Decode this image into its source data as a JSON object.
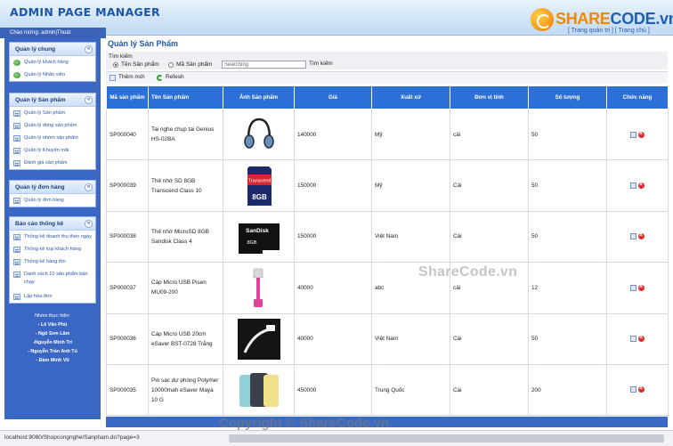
{
  "header": {
    "title": "ADMIN PAGE MANAGER",
    "logo_part1": "SHARE",
    "logo_part2": "CODE.vn",
    "logo_links": "[ Trang quản trị ] [ Trang chủ ]"
  },
  "greeting": "Chào mừng: admin|Thoát",
  "sidebar": {
    "panels": [
      {
        "title": "Quản lý chung",
        "items": [
          "Quản lý khách hàng",
          "Quản lý Nhân viên"
        ]
      },
      {
        "title": "Quản lý Sản phẩm",
        "items": [
          "Quản lý Sản phẩm",
          "Quản lý dòng sản phẩm",
          "Quản lý nhóm sản phẩm",
          "Quản lý Khuyến mãi",
          "Đánh giá sản phẩm"
        ]
      },
      {
        "title": "Quản lý đơn hàng",
        "items": [
          "Quản lý đơn hàng"
        ]
      },
      {
        "title": "Báo cáo thống kê",
        "items": [
          "Thống kê doanh thu theo ngày",
          "Thống kê loại khách hàng",
          "Thống kê hàng tồn",
          "Danh sách 10 sản phẩm bán chạy",
          "Lập hóa đơn"
        ]
      }
    ],
    "collapse_symbol": "«",
    "credits_title": "Nhóm thực hiện:",
    "credits": [
      "- Lê Văn Phú",
      "- Ngô Sơn Lâm",
      "-Nguyễn Minh Trí",
      "- Nguyễn Trần Anh Tú",
      "- Đàm Minh Vũ"
    ]
  },
  "main": {
    "title": "Quản lý Sản Phẩm",
    "search": {
      "label": "Tìm kiếm",
      "option1": "Tên Sản phẩm",
      "option2": "Mã Sản phẩm",
      "placeholder": "Searching",
      "button": "Tìm kiếm"
    },
    "toolbar": {
      "add": "Thêm mới",
      "refresh": "Refesh"
    },
    "columns": [
      "Mã sản phẩm",
      "Tên Sản phẩm",
      "Ảnh Sản phẩm",
      "Giá",
      "Xuất xứ",
      "Đơn vị tính",
      "Số lượng",
      "Chức năng"
    ],
    "rows": [
      {
        "id": "SP000040",
        "name": "Tai nghe chụp tai Genius HS-02BA",
        "image": "headphones",
        "price": "140000",
        "origin": "Mỹ",
        "unit": "cái",
        "qty": "50"
      },
      {
        "id": "SP000039",
        "name": "Thẻ nhớ SD 8GB Transcend Class 10",
        "image": "sd-card",
        "price": "150000",
        "origin": "Mỹ",
        "unit": "Cái",
        "qty": "50"
      },
      {
        "id": "SP000038",
        "name": "Thẻ nhớ MicroSD 8GB Sandisk Class 4",
        "image": "microsd-card",
        "price": "150000",
        "origin": "Việt Nam",
        "unit": "Cái",
        "qty": "50"
      },
      {
        "id": "SP000037",
        "name": "Cáp Micro USB Pisen MU09-200",
        "image": "usb-cable-pink",
        "price": "40000",
        "origin": "abc",
        "unit": "cái",
        "qty": "12"
      },
      {
        "id": "SP000036",
        "name": "Cáp Micro USB 20cm eSaver BST-0728 Trắng",
        "image": "usb-cable-white",
        "price": "40000",
        "origin": "Việt Nam",
        "unit": "Cái",
        "qty": "50"
      },
      {
        "id": "SP000035",
        "name": "Pin sạc dự phòng Polymer 10000mah eSaver Maya 10 G",
        "image": "power-bank",
        "price": "450000",
        "origin": "Trung Quốc",
        "unit": "Cái",
        "qty": "200"
      }
    ]
  },
  "thumb_text": {
    "sd_brand": "Transcend",
    "sd_size": "8GB",
    "micro_brand": "SanDisk",
    "micro_size": "8GB"
  },
  "watermarks": {
    "center": "ShareCode.vn",
    "bottom": "Copyright © ShareCode.vn"
  },
  "status_url": "localhost:8080/Shopcongnghe/Sanpham.do?page=3",
  "colors": {
    "header_blue": "#1d55a8",
    "table_header": "#2c6fd6",
    "sidebar_bg": "#3b67c4",
    "logo_orange": "#f28a00",
    "delete_red": "#e02c2c"
  }
}
